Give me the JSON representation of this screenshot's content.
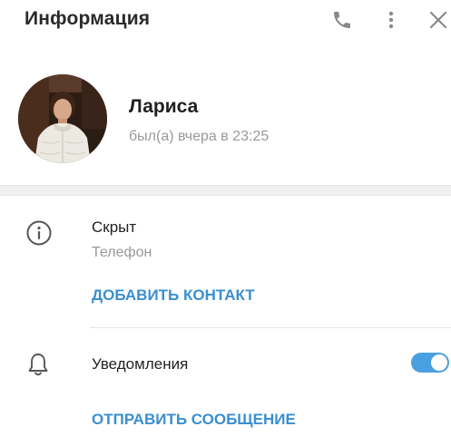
{
  "header": {
    "title": "Информация",
    "icons": [
      "phone-icon",
      "more-vertical-icon",
      "close-icon"
    ]
  },
  "profile": {
    "name": "Лариса",
    "last_seen": "был(а) вчера в 23:25"
  },
  "phone": {
    "value": "Скрыт",
    "label": "Телефон",
    "add_contact_label": "ДОБАВИТЬ КОНТАКТ"
  },
  "notifications": {
    "label": "Уведомления",
    "enabled": true
  },
  "actions": {
    "send_message_label": "ОТПРАВИТЬ СООБЩЕНИЕ"
  },
  "colors": {
    "accent": "#3a8fd0",
    "toggle_on": "#4a9fe0",
    "secondary_text": "#999999",
    "icon_gray": "#8a8a8a"
  }
}
